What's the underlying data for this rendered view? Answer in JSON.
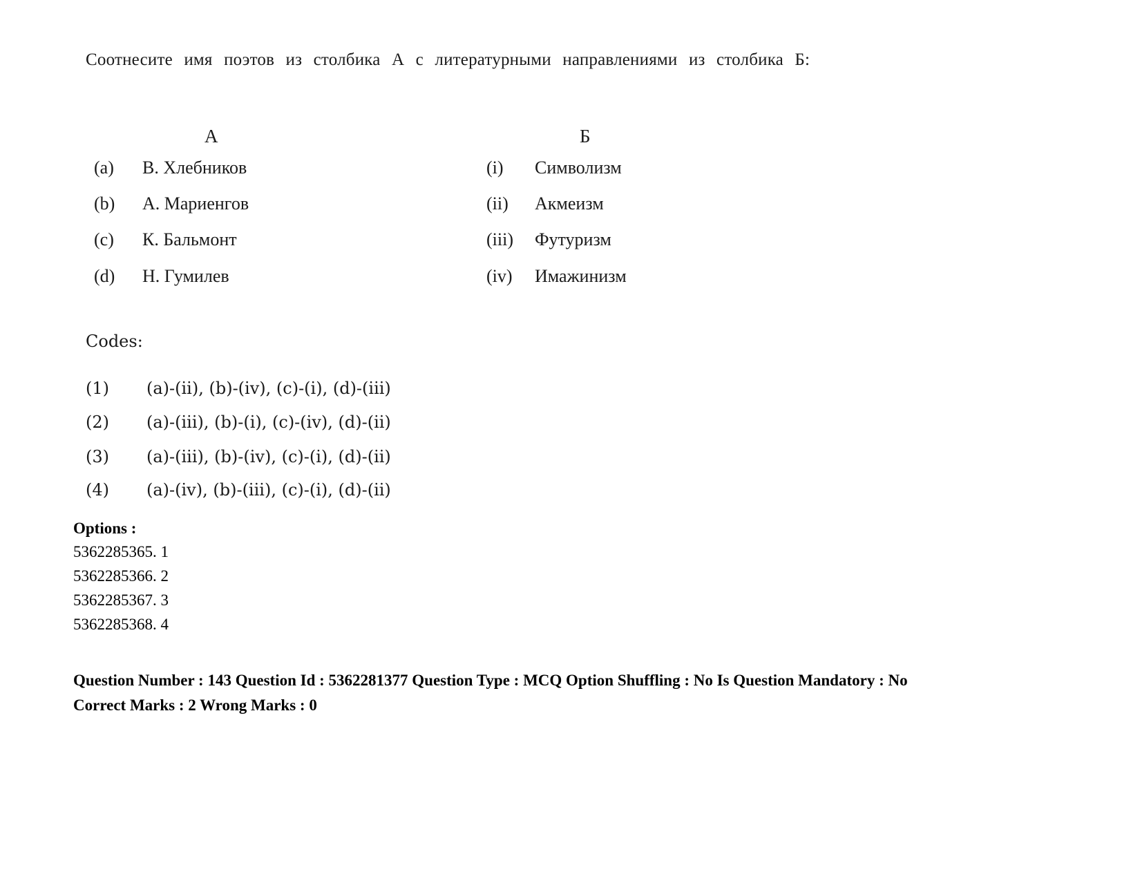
{
  "question": {
    "prompt": "Соотнесите имя поэтов из столбика А с литературными направлениями из столбика Б:",
    "column_a_header": "А",
    "column_b_header": "Б",
    "column_a": [
      {
        "label": "(a)",
        "text": "В. Хлебников"
      },
      {
        "label": "(b)",
        "text": "А. Мариенгов"
      },
      {
        "label": "(c)",
        "text": "К. Бальмонт"
      },
      {
        "label": "(d)",
        "text": "Н. Гумилев"
      }
    ],
    "column_b": [
      {
        "label": "(i)",
        "text": "Символизм"
      },
      {
        "label": "(ii)",
        "text": "Акмеизм"
      },
      {
        "label": "(iii)",
        "text": "Футуризм"
      },
      {
        "label": "(iv)",
        "text": "Имажинизм"
      }
    ],
    "codes_label": "Codes:",
    "codes": [
      {
        "num": "(1)",
        "value": "(a)-(ii), (b)-(iv), (c)-(i), (d)-(iii)"
      },
      {
        "num": "(2)",
        "value": "(a)-(iii), (b)-(i), (c)-(iv), (d)-(ii)"
      },
      {
        "num": "(3)",
        "value": "(a)-(iii), (b)-(iv), (c)-(i), (d)-(ii)"
      },
      {
        "num": "(4)",
        "value": "(a)-(iv), (b)-(iii), (c)-(i), (d)-(ii)"
      }
    ]
  },
  "options": {
    "label": "Options :",
    "items": [
      "5362285365. 1",
      "5362285366. 2",
      "5362285367. 3",
      "5362285368. 4"
    ]
  },
  "next_question_meta": {
    "line1": "Question Number : 143 Question Id : 5362281377 Question Type : MCQ Option Shuffling : No Is Question Mandatory : No",
    "line2": "Correct Marks : 2 Wrong Marks : 0"
  }
}
